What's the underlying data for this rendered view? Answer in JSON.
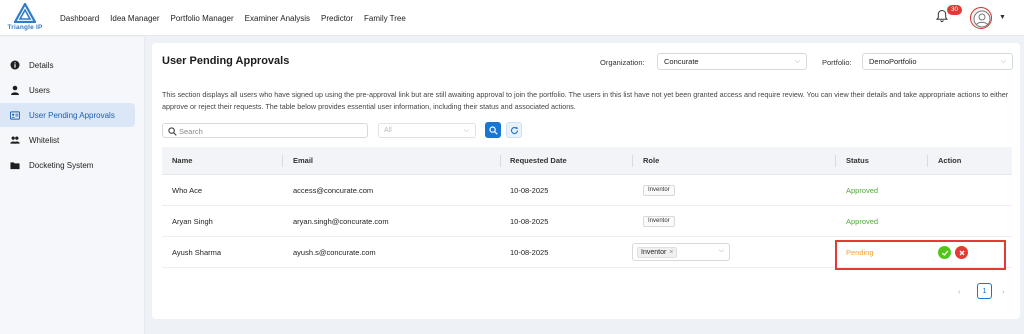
{
  "app": {
    "logo_text": "Triangle IP"
  },
  "nav": {
    "items": [
      "Dashboard",
      "Idea Manager",
      "Portfolio Manager",
      "Examiner Analysis",
      "Predictor",
      "Family Tree"
    ]
  },
  "notifications": {
    "count": "30"
  },
  "sidebar": {
    "items": [
      {
        "label": "Details",
        "icon": "info-icon"
      },
      {
        "label": "Users",
        "icon": "user-icon"
      },
      {
        "label": "User Pending Approvals",
        "icon": "id-card-icon",
        "active": true
      },
      {
        "label": "Whitelist",
        "icon": "users-icon"
      },
      {
        "label": "Docketing System",
        "icon": "folder-icon"
      }
    ]
  },
  "page": {
    "title": "User Pending Approvals",
    "organization_label": "Organization:",
    "organization_value": "Concurate",
    "portfolio_label": "Portfolio:",
    "portfolio_value": "DemoPortfolio",
    "description": "This section displays all users who have signed up using the pre-approval link but are still awaiting approval to join the portfolio. The users in this list have not yet been granted access and require review. You can view their details and take appropriate actions to either approve or reject their requests. The table below provides essential user information, including their status and associated actions."
  },
  "filters": {
    "search_placeholder": "Search",
    "role_placeholder": "All"
  },
  "table": {
    "columns": [
      "Name",
      "Email",
      "Requested Date",
      "Role",
      "Status",
      "Action"
    ],
    "rows": [
      {
        "name": "Who Ace",
        "email": "access@concurate.com",
        "date": "10-08-2025",
        "role": "Inventor",
        "status": "Approved"
      },
      {
        "name": "Aryan Singh",
        "email": "aryan.singh@concurate.com",
        "date": "10-08-2025",
        "role": "Inventor",
        "status": "Approved"
      },
      {
        "name": "Ayush Sharma",
        "email": "ayush.s@concurate.com",
        "date": "10-08-2025",
        "role": "Inventor",
        "status": "Pending"
      }
    ]
  },
  "pagination": {
    "current": "1"
  },
  "colors": {
    "accent": "#1976d2",
    "approved": "#52a93a",
    "pending": "#f2a23a",
    "reject": "#e53935",
    "approve_btn": "#52c41a"
  }
}
